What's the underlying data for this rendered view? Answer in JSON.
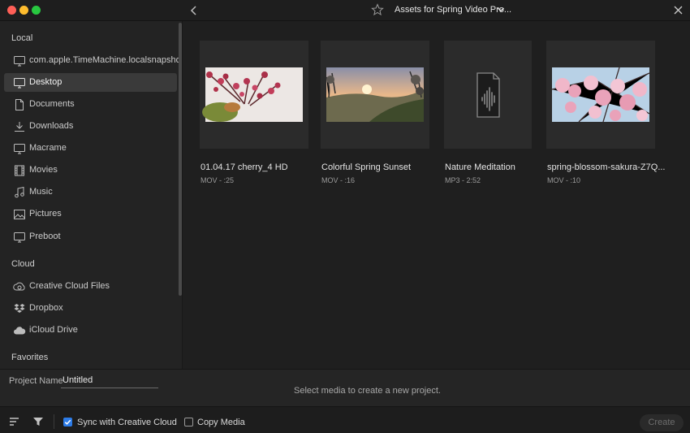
{
  "window": {
    "title": "Assets for Spring Video Pro..."
  },
  "sidebar": {
    "sections": {
      "local": "Local",
      "cloud": "Cloud",
      "favorites": "Favorites"
    },
    "local_items": [
      {
        "label": "com.apple.TimeMachine.localsnapshots",
        "icon": "monitor-icon"
      },
      {
        "label": "Desktop",
        "icon": "monitor-icon",
        "selected": true
      },
      {
        "label": "Documents",
        "icon": "document-icon"
      },
      {
        "label": "Downloads",
        "icon": "download-icon"
      },
      {
        "label": "Macrame",
        "icon": "monitor-icon"
      },
      {
        "label": "Movies",
        "icon": "film-icon"
      },
      {
        "label": "Music",
        "icon": "music-note-icon"
      },
      {
        "label": "Pictures",
        "icon": "image-icon"
      },
      {
        "label": "Preboot",
        "icon": "monitor-icon"
      }
    ],
    "cloud_items": [
      {
        "label": "Creative Cloud Files",
        "icon": "creative-cloud-icon"
      },
      {
        "label": "Dropbox",
        "icon": "dropbox-icon"
      },
      {
        "label": "iCloud Drive",
        "icon": "cloud-icon"
      }
    ]
  },
  "media": [
    {
      "title": "01.04.17 cherry_4 HD",
      "meta": "MOV - :25"
    },
    {
      "title": "Colorful Spring Sunset",
      "meta": "MOV - :16"
    },
    {
      "title": "Nature Meditation",
      "meta": "MP3 - 2:52"
    },
    {
      "title": "spring-blossom-sakura-Z7Q...",
      "meta": "MOV - :10"
    }
  ],
  "project": {
    "name_label": "Project Name",
    "name_value": "Untitled",
    "hint": "Select media to create a new project."
  },
  "footer": {
    "sync_label": "Sync with Creative Cloud",
    "copy_label": "Copy Media",
    "create_label": "Create"
  },
  "colors": {
    "accent": "#2d7ce8",
    "background": "#1f1f1f"
  }
}
